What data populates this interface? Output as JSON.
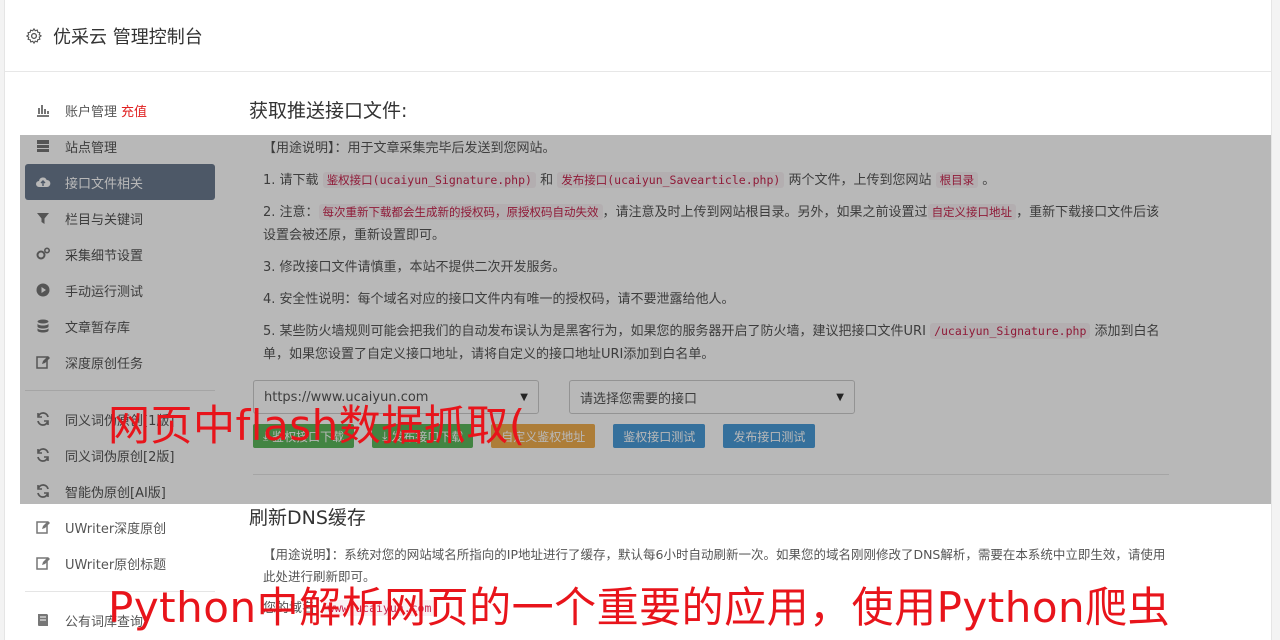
{
  "header": {
    "title": "优采云 管理控制台",
    "icon": "gear-icon"
  },
  "sidebar": {
    "items": [
      {
        "label": "账户管理",
        "extra": "充值",
        "icon": "bar-chart-icon"
      },
      {
        "label": "站点管理",
        "icon": "server-icon"
      },
      {
        "label": "接口文件相关",
        "icon": "cloud-upload-icon",
        "active": true
      },
      {
        "label": "栏目与关键词",
        "icon": "filter-icon"
      },
      {
        "label": "采集细节设置",
        "icon": "cogs-icon"
      },
      {
        "label": "手动运行测试",
        "icon": "play-circle-icon"
      },
      {
        "label": "文章暂存库",
        "icon": "database-icon"
      },
      {
        "label": "深度原创任务",
        "icon": "edit-icon"
      },
      {
        "label": "同义词伪原创[1版]",
        "icon": "refresh-icon"
      },
      {
        "label": "同义词伪原创[2版]",
        "icon": "refresh-icon"
      },
      {
        "label": "智能伪原创[AI版]",
        "icon": "refresh-icon"
      },
      {
        "label": "UWriter深度原创",
        "icon": "edit-icon"
      },
      {
        "label": "UWriter原创标题",
        "icon": "edit-icon"
      },
      {
        "label": "公有词库查询",
        "icon": "book-icon"
      }
    ]
  },
  "push": {
    "title": "获取推送接口文件:",
    "usage_label": "【用途说明】",
    "usage_text": "：用于文章采集完毕后发送到您网站。",
    "l1_a": "1. 请下载",
    "l1_code1": "鉴权接口(ucaiyun_Signature.php)",
    "l1_b": "和",
    "l1_code2": "发布接口(ucaiyun_Savearticle.php)",
    "l1_c": "两个文件，上传到您网站",
    "l1_code3": "根目录",
    "l1_d": "。",
    "l2_a": "2. 注意：",
    "l2_code1": "每次重新下载都会生成新的授权码，原授权码自动失效",
    "l2_b": "，请注意及时上传到网站根目录。另外，如果之前设置过",
    "l2_code2": "自定义接口地址",
    "l2_c": "，重新下载接口文件后该设置会被还原，重新设置即可。",
    "l3": "3. 修改接口文件请慎重，本站不提供二次开发服务。",
    "l4": "4. 安全性说明：每个域名对应的接口文件内有唯一的授权码，请不要泄露给他人。",
    "l5_a": "5. 某些防火墙规则可能会把我们的自动发布误认为是黑客行为，如果您的服务器开启了防火墙，建议把接口文件URI",
    "l5_code": "/ucaiyun_Signature.php",
    "l5_b": "添加到白名单，如果您设置了自定义接口地址，请将自定义的接口地址URI添加到白名单。",
    "site_select": "https://www.ucaiyun.com",
    "api_select": "请选择您需要的接口",
    "btn_sign_dl": "鉴权接口下载",
    "btn_pub_dl": "发布接口下载",
    "btn_custom": "自定义鉴权地址",
    "btn_sign_test": "鉴权接口测试",
    "btn_pub_test": "发布接口测试"
  },
  "dns": {
    "title": "刷新DNS缓存",
    "usage_label": "【用途说明】",
    "usage_text": "：系统对您的网站域名所指向的IP地址进行了缓存，默认每6小时自动刷新一次。如果您的域名刚刚修改了DNS解析，需要在本系统中立即生效，请使用此处进行刷新即可。",
    "domain_label": "您的域名:",
    "domain_value": "www.ucaiyun.com"
  },
  "watermarks": {
    "top": "网页中flash数据抓取(",
    "bottom": "Python中解析网页的一个重要的应用，使用Python爬虫"
  },
  "colors": {
    "active_bg": "#6b7a8f",
    "green": "#5cb85c",
    "orange": "#f0ad4e",
    "blue": "#4a9bd8",
    "code": "#c7254e",
    "watermark": "#e8141b"
  }
}
